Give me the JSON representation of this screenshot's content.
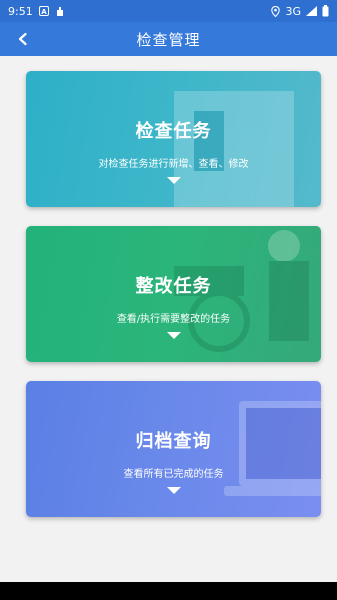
{
  "status_bar": {
    "time": "9:51",
    "network": "3G"
  },
  "header": {
    "title": "检查管理"
  },
  "cards": [
    {
      "title": "检查任务",
      "description": "对检查任务进行新增、查看、修改"
    },
    {
      "title": "整改任务",
      "description": "查看/执行需要整改的任务"
    },
    {
      "title": "归档查询",
      "description": "查看所有已完成的任务"
    }
  ],
  "icons": {
    "back": "chevron-left-icon",
    "expand": "caret-down-icon"
  },
  "colors": {
    "app_bar": "#3579db",
    "status_bar": "#2f6fd0",
    "card_inspection": "#3eb6c9",
    "card_rectification": "#2bb57a",
    "card_archive": "#6a89ea",
    "background": "#f2f2f2"
  }
}
